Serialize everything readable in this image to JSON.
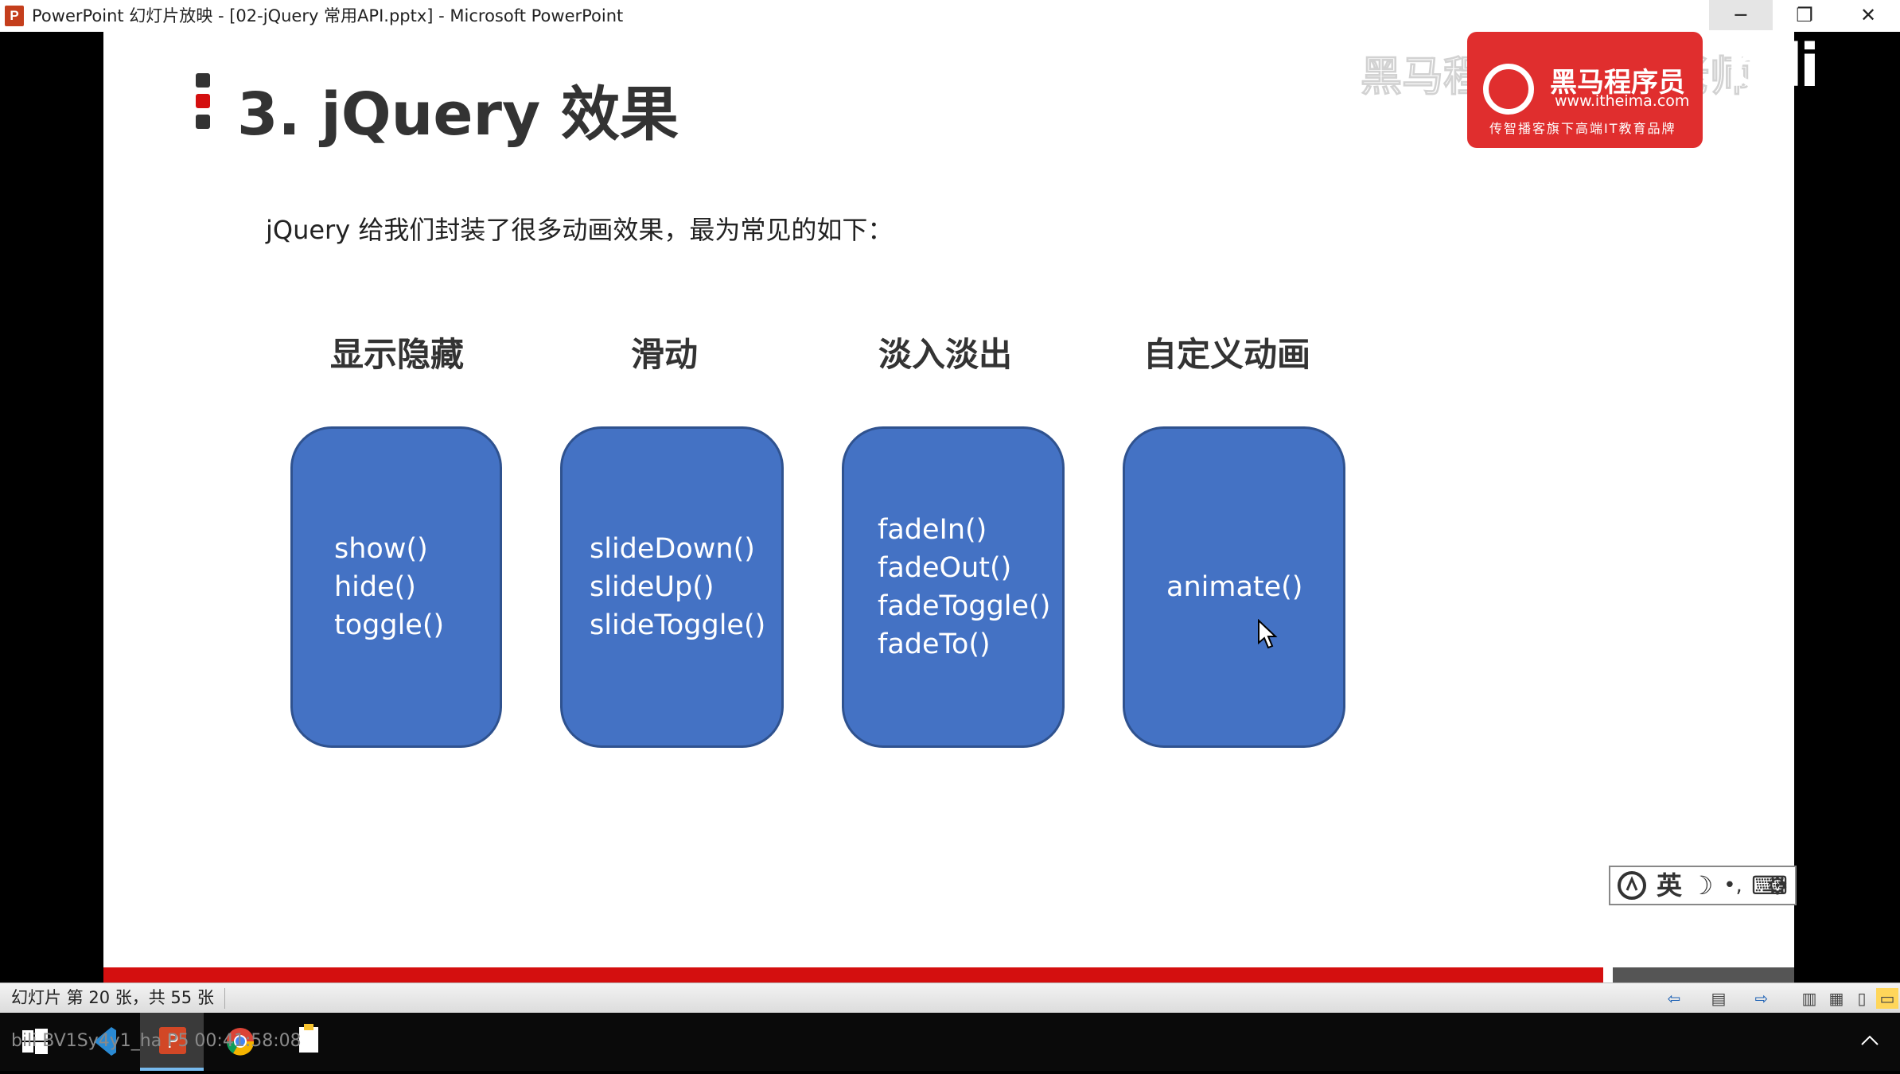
{
  "window": {
    "icon_letter": "P",
    "title": "PowerPoint 幻灯片放映 - [02-jQuery 常用API.pptx] - Microsoft PowerPoint",
    "minimize": "─",
    "maximize": "❐",
    "close": "✕"
  },
  "slide": {
    "title": "3. jQuery 效果",
    "subtitle": "jQuery 给我们封装了很多动画效果，最为常见的如下：",
    "categories": [
      {
        "heading": "显示隐藏",
        "methods": [
          "show()",
          "hide()",
          "toggle()"
        ]
      },
      {
        "heading": "滑动",
        "methods": [
          "slideDown()",
          "slideUp()",
          "slideToggle()"
        ]
      },
      {
        "heading": "淡入淡出",
        "methods": [
          "fadeIn()",
          "fadeOut()",
          "fadeToggle()",
          "fadeTo()"
        ]
      },
      {
        "heading": "自定义动画",
        "methods": [
          "animate()"
        ]
      }
    ],
    "box_color": "#4472c4",
    "accent": "#d40f0f"
  },
  "overlay": {
    "watermark": "黑马程序员pink老师",
    "logo_name": "黑马程序员",
    "logo_url": "www.itheima.com",
    "logo_tagline": "传智播客旗下高端IT教育品牌",
    "bilibili": "bili"
  },
  "ime": {
    "mode": "英",
    "moon": "☽",
    "punct": "•,",
    "keyboard": "⌨",
    "settings": "⚙"
  },
  "statusbar": {
    "slide_info": "幻灯片 第 20 张，共 55 张"
  },
  "taskbar": {
    "overlay_text": "bili  BV1Sy4y1_ha P5  00:41:58:08"
  }
}
